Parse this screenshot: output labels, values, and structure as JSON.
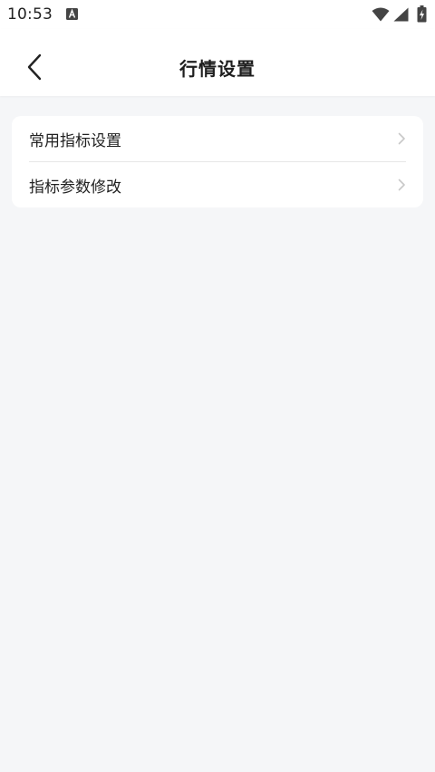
{
  "status_bar": {
    "time": "10:53",
    "notification_icon": "a-square-icon",
    "wifi_icon": "wifi-icon",
    "signal_icon": "cell-signal-icon",
    "battery_icon": "battery-charging-icon"
  },
  "app_bar": {
    "title": "行情设置",
    "back_icon": "chevron-left-icon"
  },
  "settings": {
    "items": [
      {
        "label": "常用指标设置",
        "icon": "chevron-right-icon"
      },
      {
        "label": "指标参数修改",
        "icon": "chevron-right-icon"
      }
    ]
  },
  "colors": {
    "background": "#f5f6f8",
    "card": "#ffffff",
    "text": "#222222",
    "chevron": "#c8c8c8",
    "divider": "#e6e6e6"
  }
}
